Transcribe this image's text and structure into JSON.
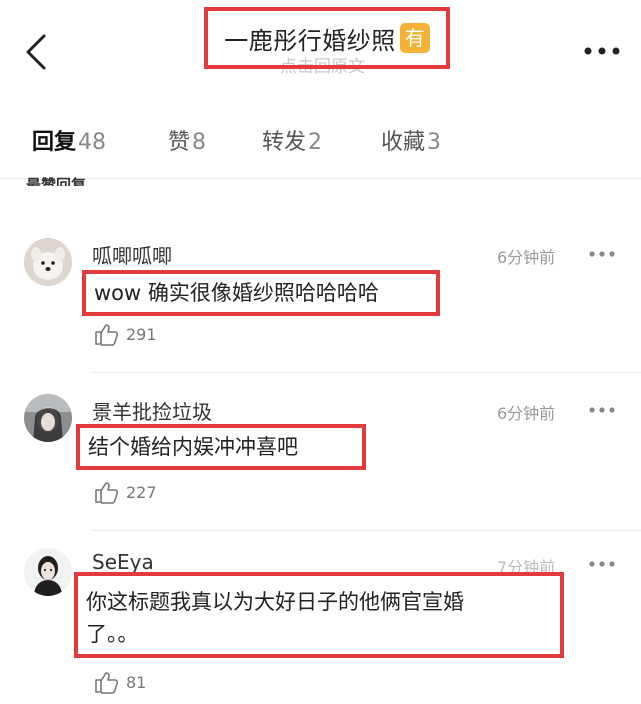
{
  "header": {
    "title": "一鹿彤行婚纱照",
    "badge": "有",
    "subtitle": "点击回原文"
  },
  "tabs": [
    {
      "label": "回复",
      "count": "48"
    },
    {
      "label": "赞",
      "count": "8"
    },
    {
      "label": "转发",
      "count": "2"
    },
    {
      "label": "收藏",
      "count": "3"
    }
  ],
  "section_label": "最赞回复",
  "comments": [
    {
      "username": "呱唧呱唧",
      "time": "6分钟前",
      "text": "wow 确实很像婚纱照哈哈哈哈",
      "likes": "291"
    },
    {
      "username": "景羊批捡垃圾",
      "time": "6分钟前",
      "text": "结个婚给内娱冲冲喜吧",
      "likes": "227"
    },
    {
      "username": "SeEya",
      "time": "7分钟前",
      "text_line1": "你这标题我真以为大好日子的他俩官宣婚",
      "text_line2": "了。。",
      "likes": "81"
    }
  ],
  "colors": {
    "highlight_border": "#e33b3b",
    "badge": "#f5b237"
  },
  "icons": {
    "back": "chevron-left-icon",
    "more": "more-horizontal-icon",
    "like": "thumbs-up-icon"
  }
}
